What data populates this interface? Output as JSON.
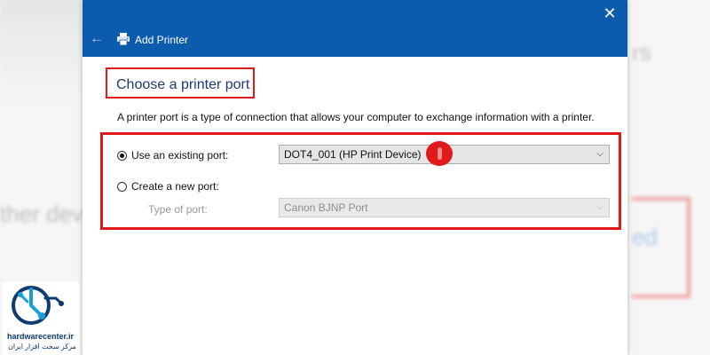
{
  "window": {
    "title": "Add Printer",
    "close_glyph": "✕",
    "back_glyph": "←"
  },
  "page": {
    "heading": "Choose a printer port",
    "description": "A printer port is a type of connection that allows your computer to exchange information with a printer."
  },
  "options": {
    "existing_label": "Use an existing port:",
    "existing_selected": true,
    "existing_value": "DOT4_001 (HP Print Device)",
    "new_label": "Create a new port:",
    "new_selected": false,
    "type_label": "Type of port:",
    "type_value": "Canon BJNP Port"
  },
  "background": {
    "ghost_right_top": "rs",
    "ghost_left_mid": "ther dev",
    "ghost_right_mid": "ed"
  },
  "watermark": {
    "site": "hardwarecenter.ir",
    "tagline": "مرکز سخت افزار ایران"
  },
  "colors": {
    "titlebar": "#0b5cad",
    "highlight": "#e0191b",
    "heading": "#1e3a7b"
  },
  "icons": [
    "back-arrow-icon",
    "printer-icon",
    "close-icon",
    "chevron-down-icon"
  ]
}
